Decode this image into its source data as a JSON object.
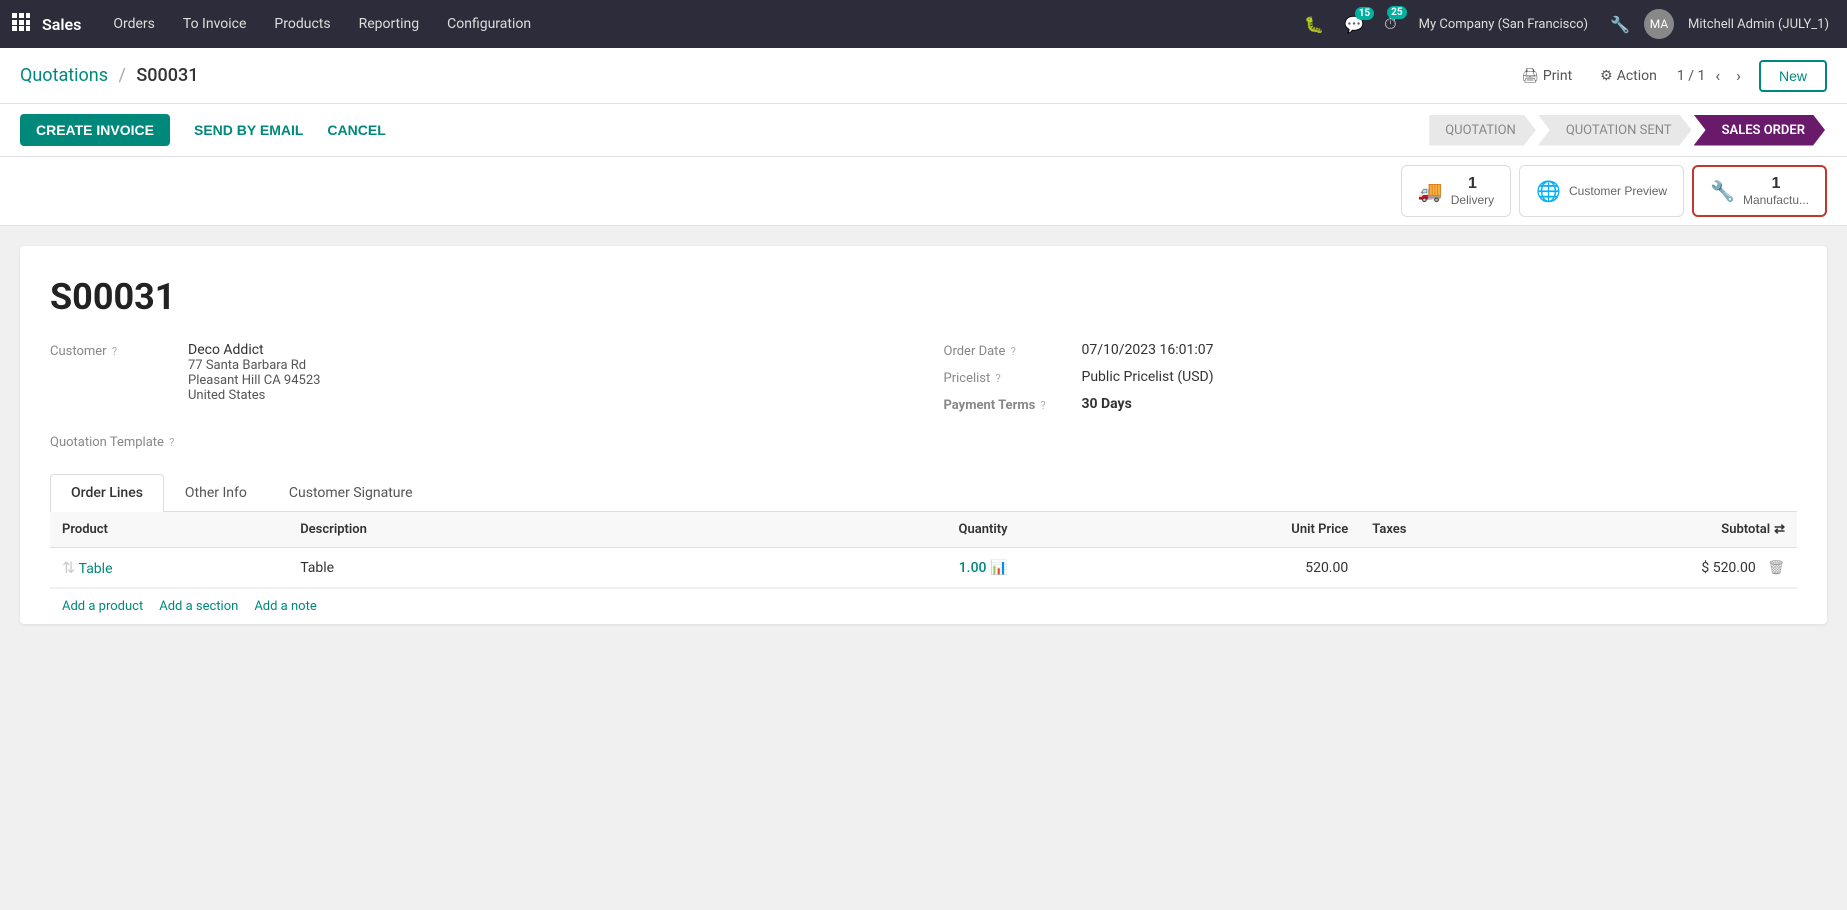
{
  "topnav": {
    "app_name": "Sales",
    "nav_items": [
      "Orders",
      "To Invoice",
      "Products",
      "Reporting",
      "Configuration"
    ],
    "badge_messages": "15",
    "badge_clock": "25",
    "company": "My Company (San Francisco)",
    "user": "Mitchell Admin (JULY_1)"
  },
  "breadcrumb": {
    "parent": "Quotations",
    "separator": "/",
    "current": "S00031",
    "print_label": "Print",
    "action_label": "Action",
    "page_info": "1 / 1",
    "new_label": "New"
  },
  "action_bar": {
    "create_invoice_label": "CREATE INVOICE",
    "send_email_label": "SEND BY EMAIL",
    "cancel_label": "CANCEL",
    "steps": [
      {
        "label": "QUOTATION",
        "active": false
      },
      {
        "label": "QUOTATION SENT",
        "active": false
      },
      {
        "label": "SALES ORDER",
        "active": true
      }
    ]
  },
  "smart_buttons": [
    {
      "id": "delivery",
      "icon": "🚚",
      "count": "1",
      "label": "Delivery",
      "highlighted": false
    },
    {
      "id": "customer_preview",
      "icon": "🌐",
      "count": "",
      "label": "Customer Preview",
      "highlighted": false
    },
    {
      "id": "manufacturing",
      "icon": "🔧",
      "count": "1",
      "label": "Manufactu...",
      "highlighted": true
    }
  ],
  "form": {
    "title": "S00031",
    "customer_label": "Customer",
    "customer_name": "Deco Addict",
    "customer_address1": "77 Santa Barbara Rd",
    "customer_address2": "Pleasant Hill CA 94523",
    "customer_address3": "United States",
    "order_date_label": "Order Date",
    "order_date_value": "07/10/2023 16:01:07",
    "pricelist_label": "Pricelist",
    "pricelist_value": "Public Pricelist (USD)",
    "payment_terms_label": "Payment Terms",
    "payment_terms_value": "30 Days",
    "quotation_template_label": "Quotation Template"
  },
  "tabs": [
    {
      "id": "order_lines",
      "label": "Order Lines",
      "active": true
    },
    {
      "id": "other_info",
      "label": "Other Info",
      "active": false
    },
    {
      "id": "customer_signature",
      "label": "Customer Signature",
      "active": false
    }
  ],
  "order_table": {
    "columns": [
      "Product",
      "Description",
      "Quantity",
      "Unit Price",
      "Taxes",
      "Subtotal"
    ],
    "rows": [
      {
        "product": "Table",
        "description": "Table",
        "quantity": "1.00",
        "unit_price": "520.00",
        "taxes": "",
        "subtotal": "$ 520.00"
      }
    ],
    "add_product_label": "Add a product",
    "add_section_label": "Add a section",
    "add_note_label": "Add a note"
  }
}
